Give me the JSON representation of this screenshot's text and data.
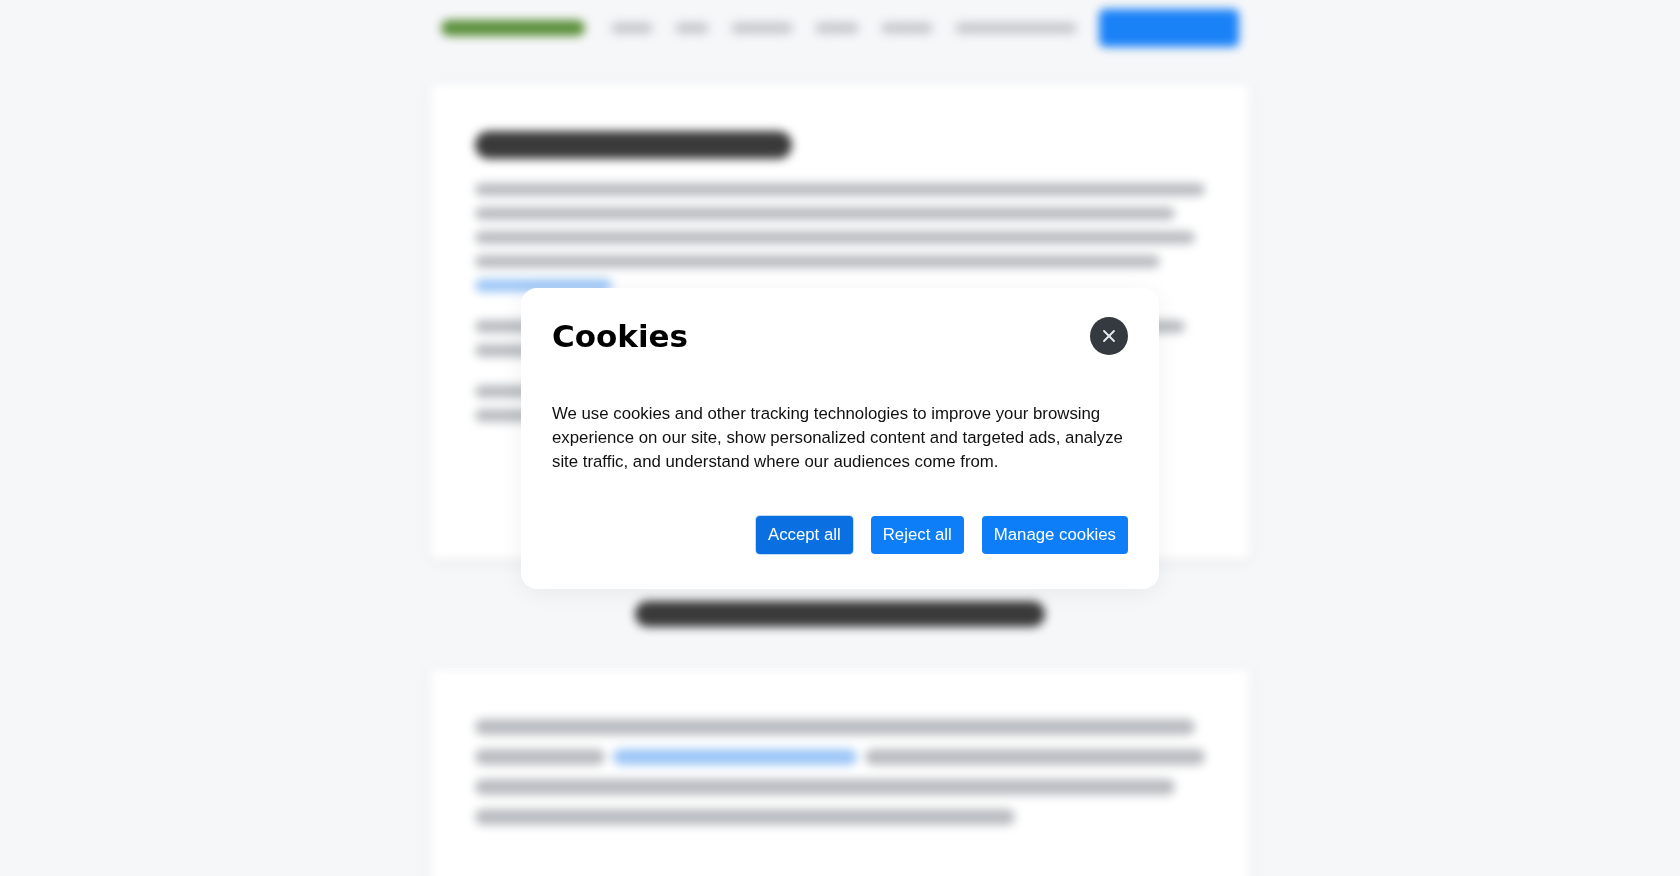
{
  "dialog": {
    "title": "Cookies",
    "message": "We use cookies and other tracking technologies to improve your browsing experience on our site, show personalized content and targeted ads, analyze site traffic, and understand where our audiences come from.",
    "buttons": [
      {
        "label": "Accept all",
        "focused": true
      },
      {
        "label": "Reject all",
        "focused": false
      },
      {
        "label": "Manage cookies",
        "focused": false
      }
    ]
  }
}
